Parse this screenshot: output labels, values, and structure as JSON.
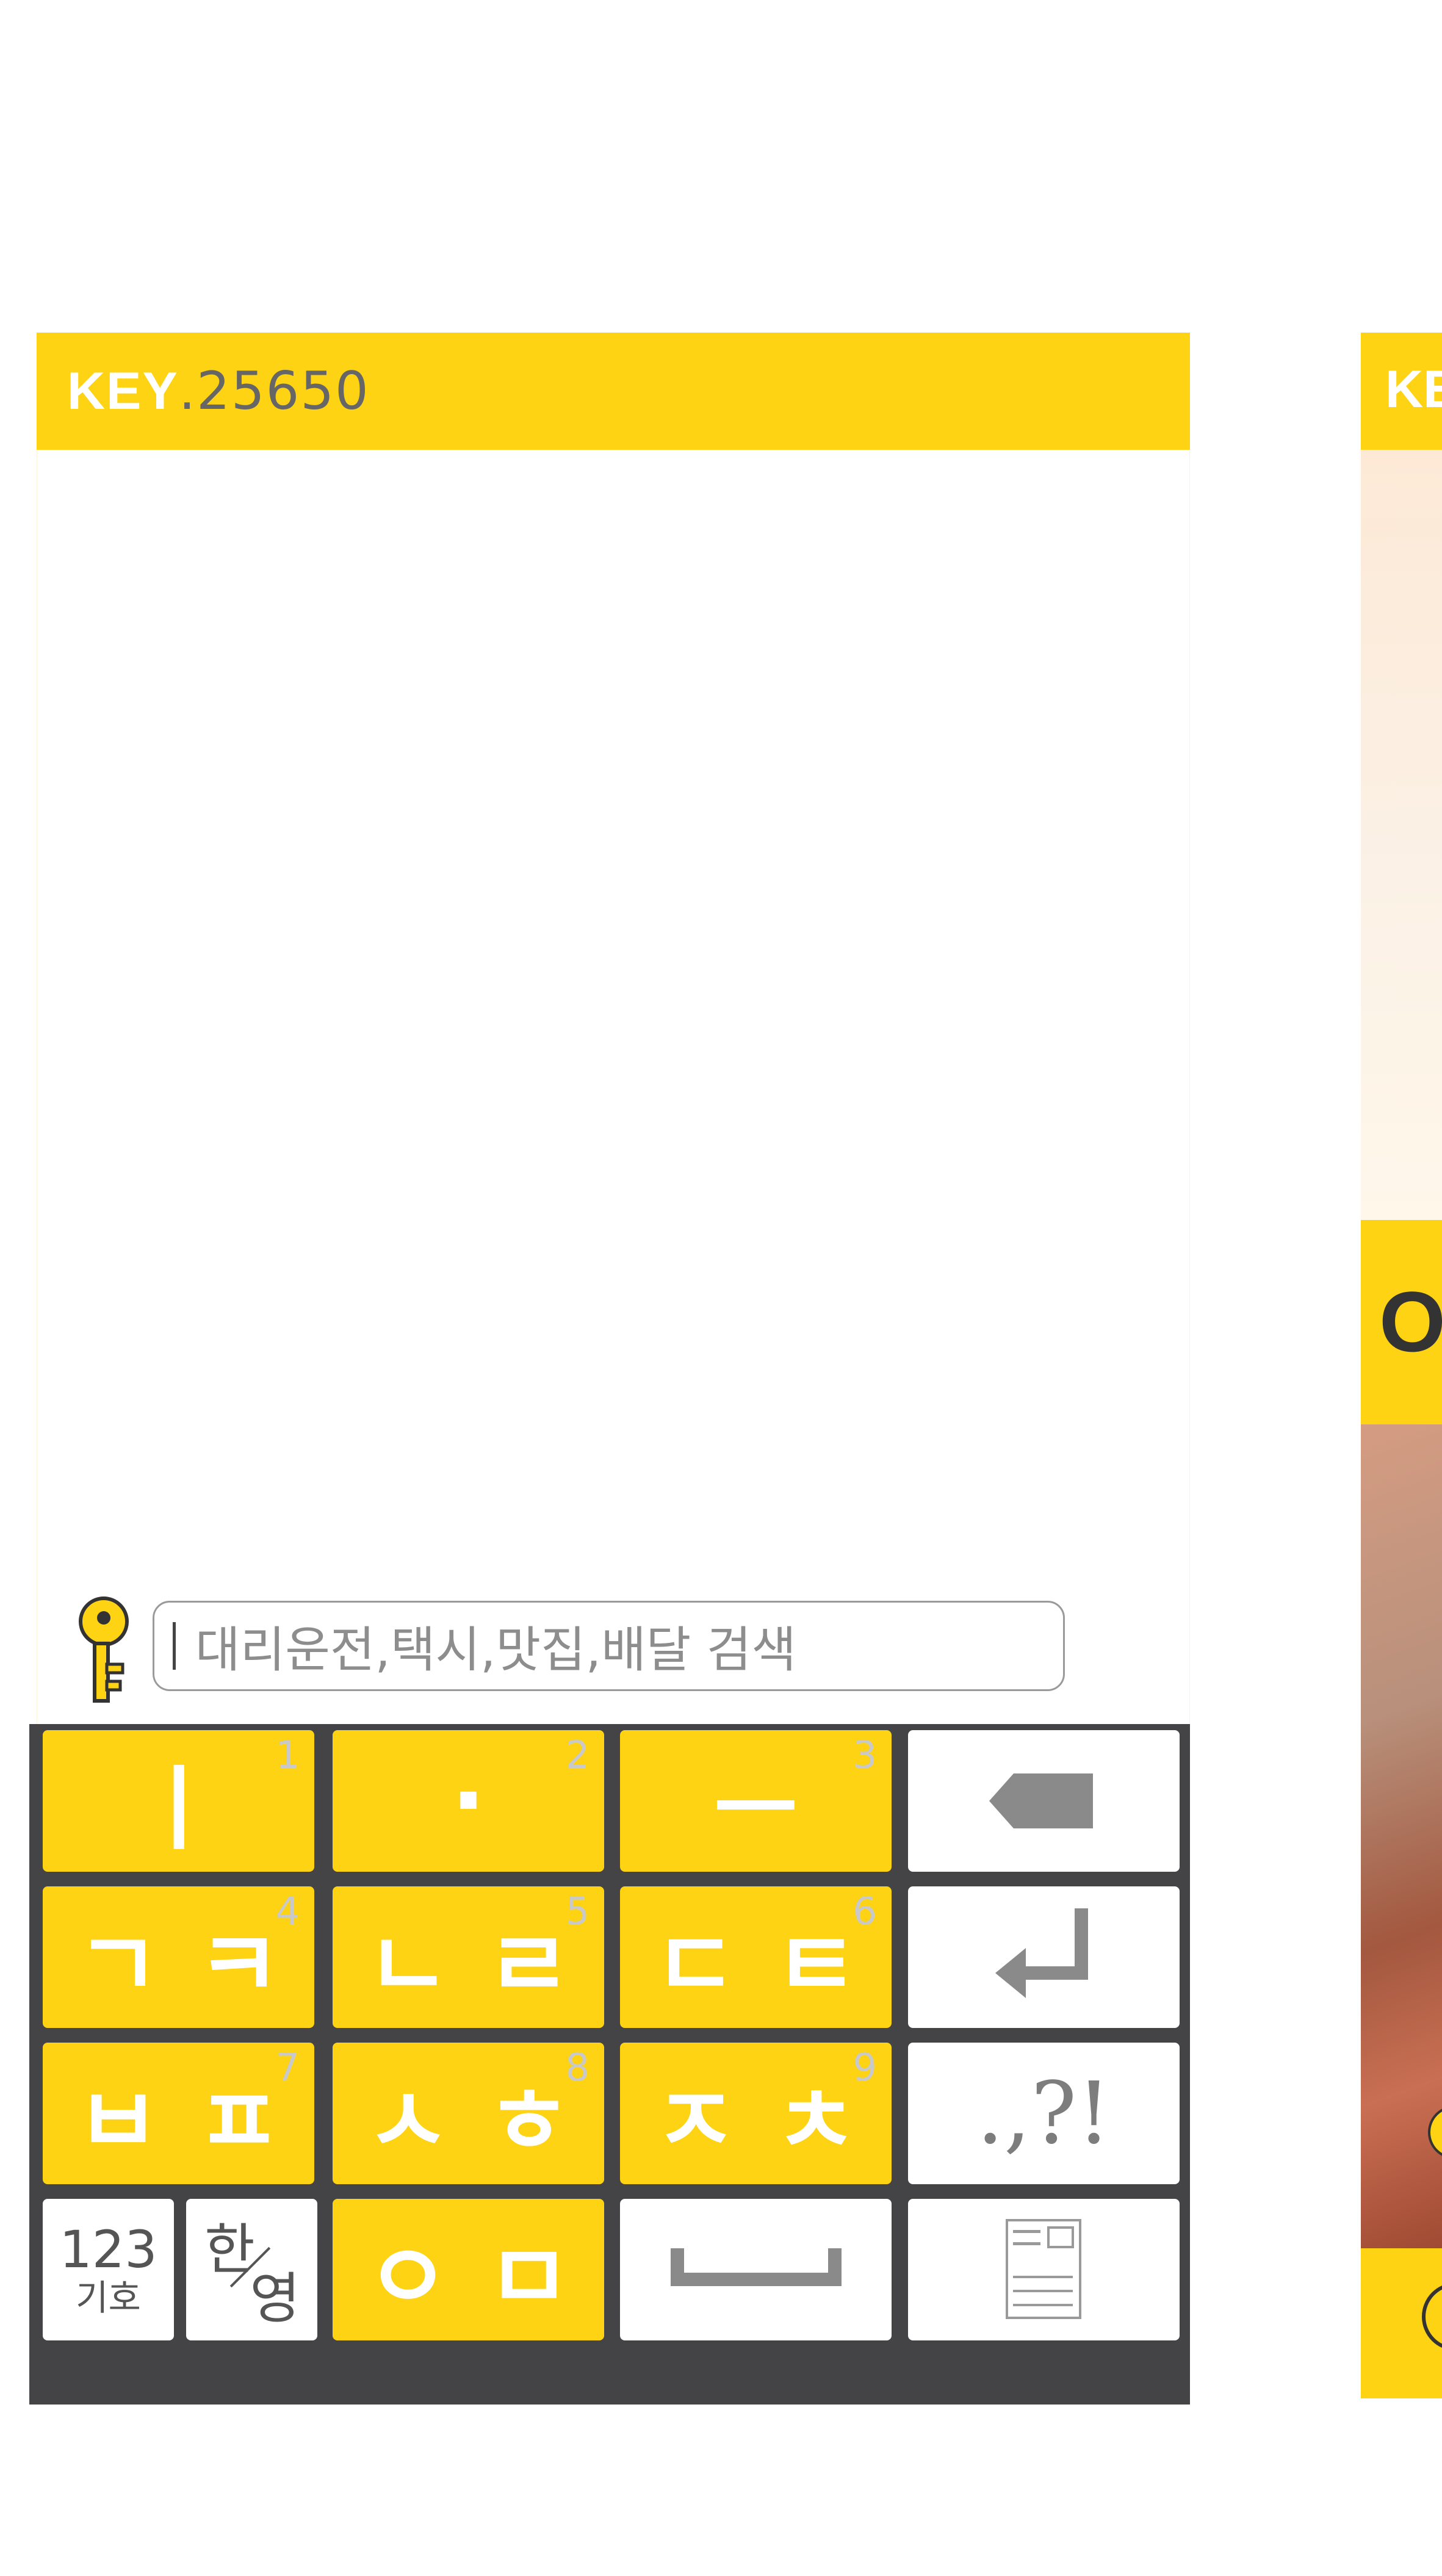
{
  "title_bar": {
    "brand": "KEY",
    "number": ".25650"
  },
  "search": {
    "placeholder": "대리운전,택시,맛집,배달 검색"
  },
  "keyboard": {
    "row1": [
      {
        "glyphs": "ㅣ",
        "num": "1"
      },
      {
        "glyphs": "·",
        "num": "2"
      },
      {
        "glyphs": "ㅡ",
        "num": "3"
      }
    ],
    "row2": [
      {
        "glyphs": "ㄱㅋ",
        "num": "4"
      },
      {
        "glyphs": "ㄴㄹ",
        "num": "5"
      },
      {
        "glyphs": "ㄷㅌ",
        "num": "6"
      }
    ],
    "row3": [
      {
        "glyphs": "ㅂㅍ",
        "num": "7"
      },
      {
        "glyphs": "ㅅㅎ",
        "num": "8"
      },
      {
        "glyphs": "ㅈㅊ",
        "num": "9"
      }
    ],
    "row4": {
      "glyphs": "ㅇㅁ"
    },
    "punct": ".,?!",
    "mode_123": {
      "top": "123",
      "bottom": "기호"
    },
    "mode_lang": {
      "top": "한",
      "bottom": "영"
    }
  },
  "right_panel": {
    "title": "KEY",
    "band_text": "O"
  },
  "colors": {
    "accent": "#fdd314",
    "keyboard_bg": "#444446",
    "white_key": "#ffffff"
  },
  "icons": [
    "key-logo-icon",
    "backspace-icon",
    "enter-icon",
    "space-icon",
    "memo-icon"
  ]
}
